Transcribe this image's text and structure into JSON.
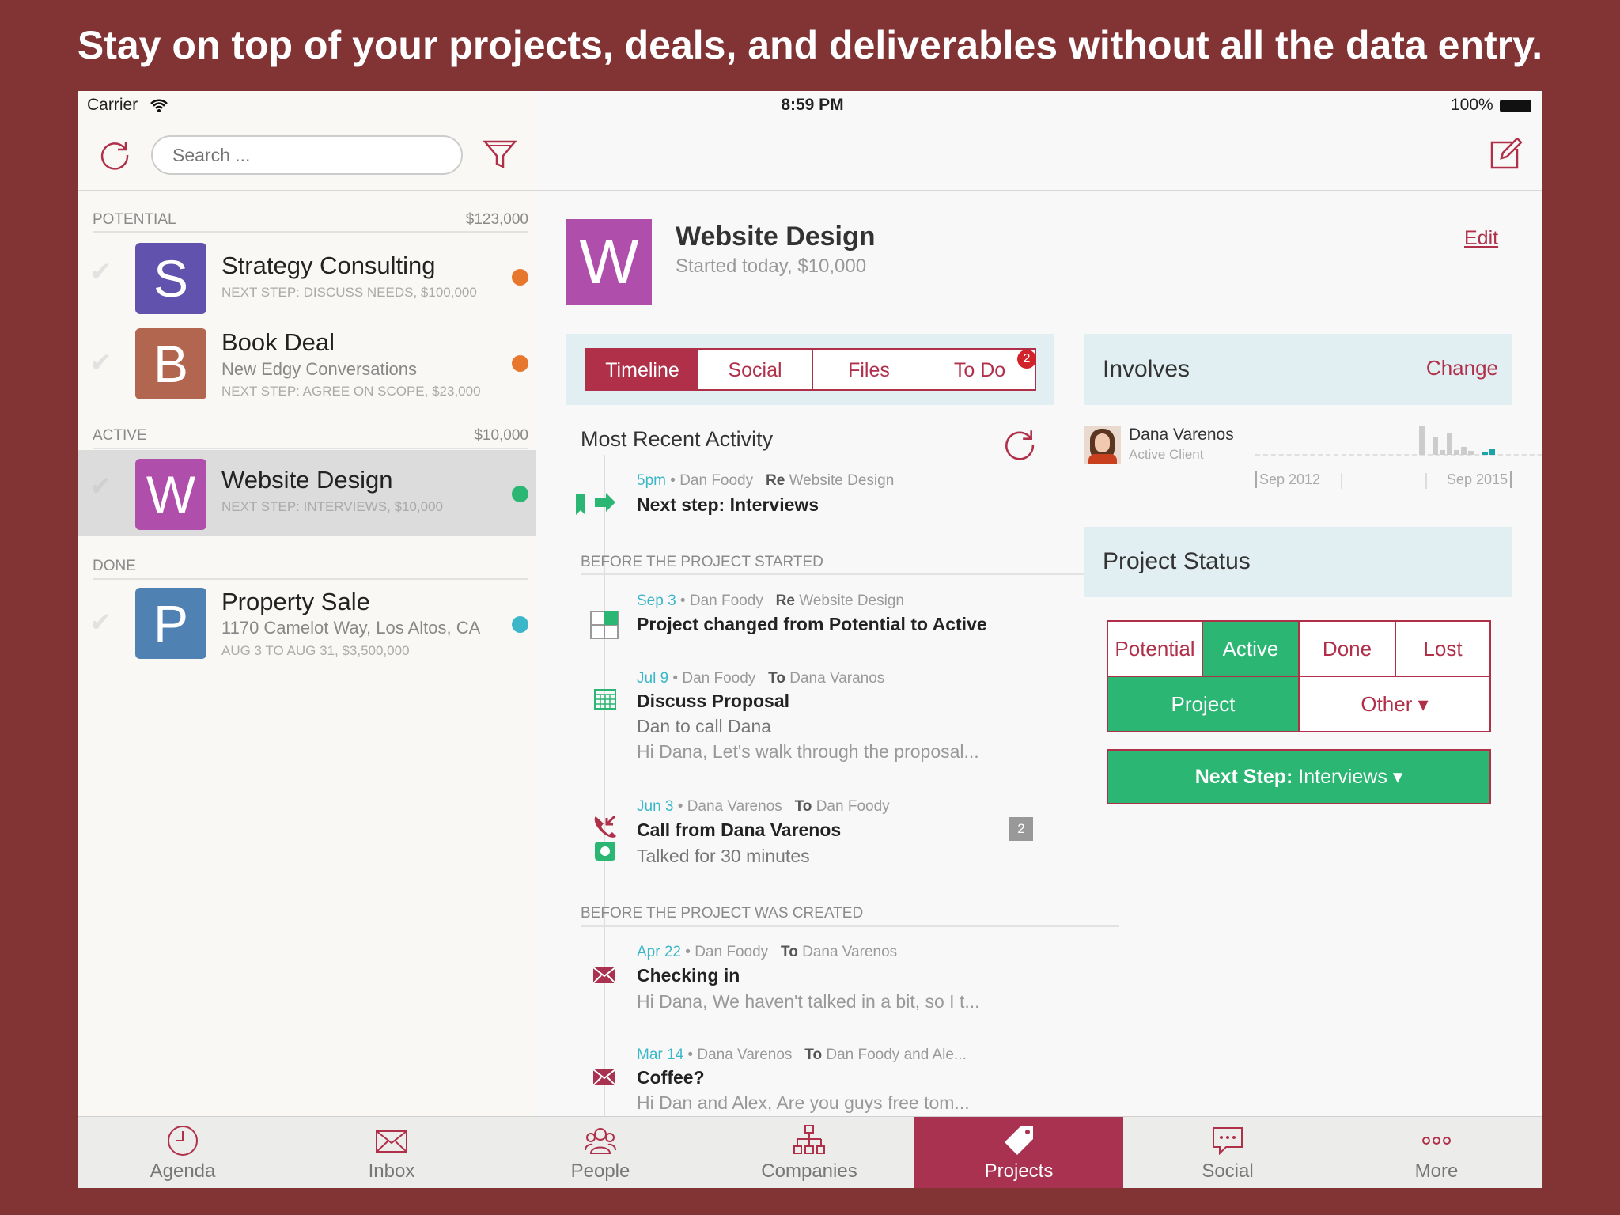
{
  "banner": "Stay on top of your projects, deals, and deliverables without all the data entry.",
  "status": {
    "carrier": "Carrier",
    "time": "8:59 PM",
    "battery": "100%"
  },
  "search": {
    "placeholder": "Search ..."
  },
  "sections": [
    {
      "label": "POTENTIAL",
      "total": "$123,000"
    },
    {
      "label": "ACTIVE",
      "total": "$10,000"
    },
    {
      "label": "DONE",
      "total": ""
    }
  ],
  "projects": [
    {
      "letter": "S",
      "title": "Strategy Consulting",
      "sub": "",
      "next": "Next step: Discuss needs, $100,000",
      "color": "#6152ae",
      "dot": "#e8772e"
    },
    {
      "letter": "B",
      "title": "Book Deal",
      "sub": "New Edgy Conversations",
      "next": "Next step: Agree on scope, $23,000",
      "color": "#b2654f",
      "dot": "#e8772e"
    },
    {
      "letter": "W",
      "title": "Website Design",
      "sub": "",
      "next": "Next step: Interviews, $10,000",
      "color": "#b04eab",
      "dot": "#2bb673",
      "selected": true
    },
    {
      "letter": "P",
      "title": "Property Sale",
      "sub": "1170 Camelot Way, Los Altos, CA",
      "next": "Aug 3 to Aug 31, $3,500,000",
      "color": "#4f82b3",
      "dot": "#3bb7c9"
    }
  ],
  "detail": {
    "letter": "W",
    "title": "Website Design",
    "subtitle": "Started today, $10,000",
    "edit": "Edit",
    "tabs": [
      "Timeline",
      "Social",
      "Files",
      "To Do"
    ],
    "active_tab": "Timeline",
    "todo_badge": "2"
  },
  "timeline": {
    "heading": "Most Recent Activity",
    "sections": [
      "BEFORE THE PROJECT STARTED",
      "BEFORE THE PROJECT WAS CREATED"
    ],
    "items": [
      {
        "when": "5pm",
        "from": "Dan Foody",
        "kw": "Re",
        "target": "Website Design",
        "title": "Next step: Interviews",
        "icon": "next-step-flag-icon"
      },
      {
        "when": "Sep 3",
        "from": "Dan Foody",
        "kw": "Re",
        "target": "Website Design",
        "title": "Project changed from Potential to Active",
        "icon": "status-change-icon"
      },
      {
        "when": "Jul 9",
        "from": "Dan Foody",
        "kw": "To",
        "target": "Dana Varanos",
        "title": "Discuss Proposal",
        "line": "Dan to call Dana",
        "preview": "Hi Dana, Let's walk through the proposal...",
        "icon": "calendar-icon"
      },
      {
        "when": "Jun 3",
        "from": "Dana Varenos",
        "kw": "To",
        "target": "Dan Foody",
        "title": "Call from Dana Varenos",
        "line": "Talked for 30 minutes",
        "comments": "2",
        "icon": "phone-incoming-icon"
      },
      {
        "when": "Apr 22",
        "from": "Dan Foody",
        "kw": "To",
        "target": "Dana Varenos",
        "title": "Checking in",
        "preview": "Hi Dana, We haven't talked in a bit, so I t...",
        "icon": "mail-icon"
      },
      {
        "when": "Mar 14",
        "from": "Dana Varenos",
        "kw": "To",
        "target": "Dan Foody and Ale...",
        "title": "Coffee?",
        "preview": "Hi Dan and Alex, Are you guys free tom...",
        "icon": "mail-icon"
      }
    ]
  },
  "involves": {
    "title": "Involves",
    "change": "Change",
    "name": "Dana Varenos",
    "role": "Active Client",
    "axis_start": "Sep 2012",
    "axis_end": "Sep 2015"
  },
  "status_panel": {
    "title": "Project Status",
    "stages": [
      "Potential",
      "Active",
      "Done",
      "Lost"
    ],
    "active_stage": "Active",
    "types": [
      "Project",
      "Other ▾"
    ],
    "active_type": "Project",
    "next_label": "Next Step:",
    "next_value": "Interviews ▾",
    "accent": "#b0304a",
    "green": "#2bb673"
  },
  "tabbar": [
    {
      "label": "Agenda"
    },
    {
      "label": "Inbox"
    },
    {
      "label": "People"
    },
    {
      "label": "Companies"
    },
    {
      "label": "Projects",
      "active": true
    },
    {
      "label": "Social"
    },
    {
      "label": "More"
    }
  ]
}
